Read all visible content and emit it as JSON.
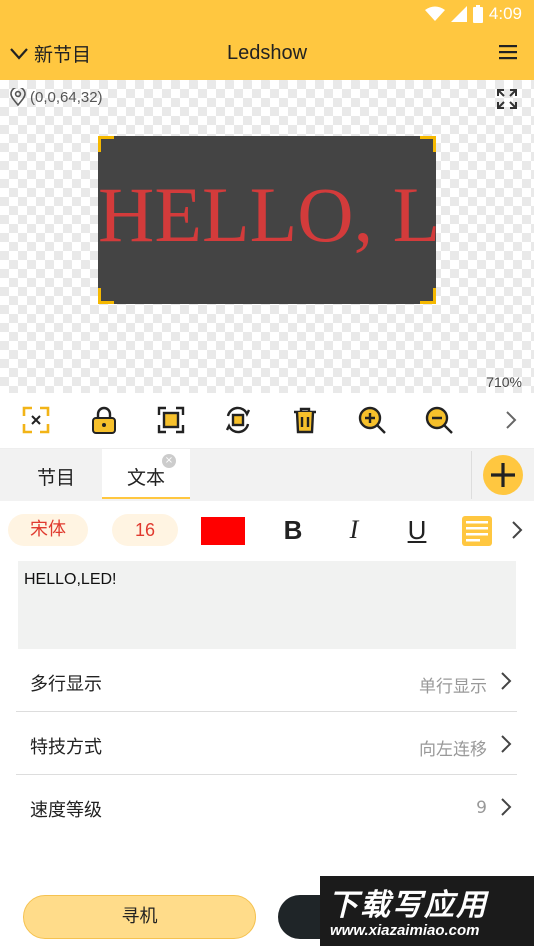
{
  "status_bar": {
    "time": "4:09"
  },
  "header": {
    "program_selector": "新节目",
    "title": "Ledshow"
  },
  "canvas": {
    "coordinates": "(0,0,64,32)",
    "display_text": "HELLO, LED!",
    "zoom": "710%",
    "background_color": "#444444",
    "text_color": "#d33b3b"
  },
  "toolbar": {
    "tools": [
      "expand-icon",
      "lock-icon",
      "fit-area-icon",
      "rotate-icon",
      "trash-icon",
      "zoom-in-icon",
      "zoom-out-icon",
      "chevron-right-icon"
    ]
  },
  "tabs": {
    "program_label": "节目",
    "text_label": "文本",
    "close_glyph": "×"
  },
  "format": {
    "font": "宋体",
    "size": "16",
    "color": "#ff0000",
    "bold": "B",
    "italic": "I",
    "underline": "U"
  },
  "text_content": "HELLO,LED!",
  "settings": [
    {
      "label": "多行显示",
      "value": "单行显示"
    },
    {
      "label": "特技方式",
      "value": "向左连移"
    },
    {
      "label": "速度等级",
      "value": "9"
    }
  ],
  "bottom": {
    "search_label": "寻机"
  },
  "watermark": {
    "title": "下载写应用",
    "url": "www.xiazaimiao.com"
  },
  "accent_color": "#ffc740"
}
